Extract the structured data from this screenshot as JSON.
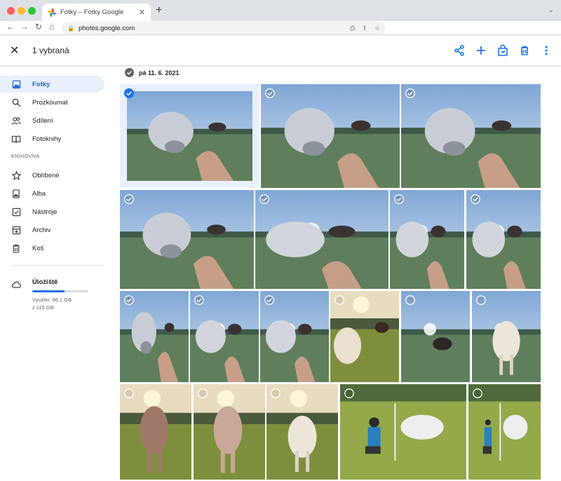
{
  "browser": {
    "tab_title": "Fotky – Fotky Google",
    "tab_close": "✕",
    "new_tab": "+",
    "url": "photos.google.com"
  },
  "appbar": {
    "close_icon": "close-icon",
    "selection_title": "1 vybraná",
    "actions": [
      "share-icon",
      "add-icon",
      "shopping-bag-icon",
      "trash-icon",
      "more-vert-icon"
    ]
  },
  "sidebar": {
    "items": [
      {
        "label": "Fotky",
        "icon": "photo-icon",
        "active": true
      },
      {
        "label": "Prozkoumat",
        "icon": "search-icon"
      },
      {
        "label": "Sdílení",
        "icon": "people-icon"
      },
      {
        "label": "Fotoknihy",
        "icon": "book-icon"
      }
    ],
    "section_label": "KNIHOVNA",
    "library": [
      {
        "label": "Oblíbené",
        "icon": "star-icon"
      },
      {
        "label": "Alba",
        "icon": "album-icon"
      },
      {
        "label": "Nástroje",
        "icon": "checklist-icon"
      },
      {
        "label": "Archiv",
        "icon": "archive-icon"
      },
      {
        "label": "Koš",
        "icon": "trash-icon"
      }
    ],
    "storage": {
      "label": "Úložiště",
      "used_fraction": 0.57,
      "used_text": "Využito: 66,1 GB",
      "total_text": "z 115 GB"
    }
  },
  "content": {
    "date_label": "pá 11. 6. 2021",
    "photos": [
      {
        "scene": "calf-closeup",
        "check": "selected"
      },
      {
        "scene": "calf-closeup",
        "check": "checked"
      },
      {
        "scene": "calf-closeup",
        "check": "checked"
      },
      {
        "scene": "calf-closeup",
        "check": "checked"
      },
      {
        "scene": "calf-side",
        "check": "checked"
      },
      {
        "scene": "calf-side",
        "check": "checked"
      },
      {
        "scene": "calf-side",
        "check": "checked"
      },
      {
        "scene": "calf-closeup",
        "check": "checked"
      },
      {
        "scene": "calf-white",
        "check": "checked"
      },
      {
        "scene": "calf-white",
        "check": "checked"
      },
      {
        "scene": "calf-golden",
        "check": "empty"
      },
      {
        "scene": "horse-field",
        "check": "empty"
      },
      {
        "scene": "calf-standing",
        "check": "empty"
      },
      {
        "scene": "cow-brown",
        "check": "empty"
      },
      {
        "scene": "cow-brown-light",
        "check": "empty"
      },
      {
        "scene": "calf-white-standing",
        "check": "empty"
      },
      {
        "scene": "person-calf",
        "check": "empty"
      },
      {
        "scene": "person-calf-small",
        "check": "empty"
      }
    ]
  },
  "colors": {
    "accent": "#1a73e8",
    "active_bg": "#e8f0fe"
  }
}
